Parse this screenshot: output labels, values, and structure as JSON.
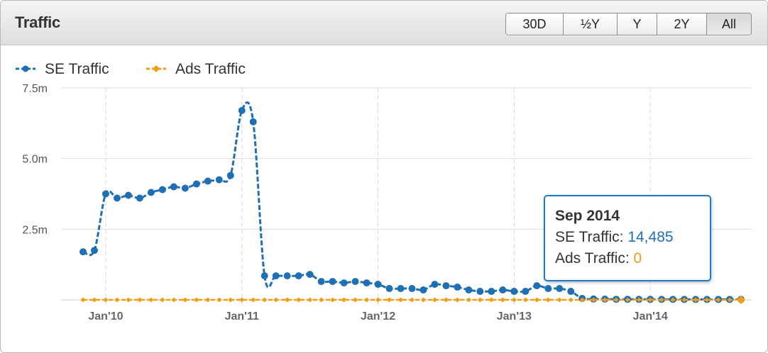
{
  "header": {
    "title": "Traffic",
    "ranges": [
      "30D",
      "½Y",
      "Y",
      "2Y",
      "All"
    ],
    "active_range": "All"
  },
  "tooltip": {
    "title": "Sep 2014",
    "se_label": "SE Traffic: ",
    "se_value": "14,485",
    "ads_label": "Ads Traffic: ",
    "ads_value": "0"
  },
  "colors": {
    "se": "#1f6fb5",
    "ads": "#f39c12",
    "grid": "#dddddd"
  },
  "chart_data": {
    "type": "line",
    "title": "",
    "xlabel": "",
    "ylabel": "",
    "x_ticks": [
      "Jan'10",
      "Jan'11",
      "Jan'12",
      "Jan'13",
      "Jan'14"
    ],
    "y_ticks": [
      "2.5m",
      "5.0m",
      "7.5m"
    ],
    "y_tick_values": [
      2500000,
      5000000,
      7500000
    ],
    "ylim": [
      0,
      7500000
    ],
    "xlim": [
      "2009-10",
      "2014-09"
    ],
    "legend": {
      "placement": "top-left"
    },
    "grid": true,
    "x": [
      "2009-11",
      "2009-12",
      "2010-01",
      "2010-02",
      "2010-03",
      "2010-04",
      "2010-05",
      "2010-06",
      "2010-07",
      "2010-08",
      "2010-09",
      "2010-10",
      "2010-11",
      "2010-12",
      "2011-01",
      "2011-02",
      "2011-03",
      "2011-04",
      "2011-05",
      "2011-06",
      "2011-07",
      "2011-08",
      "2011-09",
      "2011-10",
      "2011-11",
      "2011-12",
      "2012-01",
      "2012-02",
      "2012-03",
      "2012-04",
      "2012-05",
      "2012-06",
      "2012-07",
      "2012-08",
      "2012-09",
      "2012-10",
      "2012-11",
      "2012-12",
      "2013-01",
      "2013-02",
      "2013-03",
      "2013-04",
      "2013-05",
      "2013-06",
      "2013-07",
      "2013-08",
      "2013-09",
      "2013-10",
      "2013-11",
      "2013-12",
      "2014-01",
      "2014-02",
      "2014-03",
      "2014-04",
      "2014-05",
      "2014-06",
      "2014-07",
      "2014-08",
      "2014-09"
    ],
    "series": [
      {
        "name": "SE Traffic",
        "values": [
          1700000,
          1750000,
          3750000,
          3600000,
          3700000,
          3600000,
          3800000,
          3900000,
          4000000,
          3950000,
          4100000,
          4200000,
          4250000,
          4400000,
          6700000,
          6300000,
          850000,
          850000,
          850000,
          850000,
          900000,
          650000,
          650000,
          600000,
          650000,
          600000,
          550000,
          400000,
          400000,
          400000,
          350000,
          550000,
          500000,
          450000,
          350000,
          300000,
          300000,
          350000,
          300000,
          300000,
          500000,
          400000,
          400000,
          300000,
          50000,
          30000,
          25000,
          20000,
          20000,
          18000,
          18000,
          16000,
          16000,
          15000,
          15000,
          15000,
          14500,
          14500,
          14485
        ]
      },
      {
        "name": "Ads Traffic",
        "values": [
          0,
          0,
          0,
          0,
          0,
          0,
          0,
          0,
          0,
          0,
          0,
          0,
          0,
          0,
          0,
          0,
          0,
          0,
          0,
          0,
          0,
          0,
          0,
          0,
          0,
          0,
          0,
          0,
          0,
          0,
          0,
          0,
          0,
          0,
          0,
          0,
          0,
          0,
          0,
          0,
          0,
          0,
          0,
          0,
          0,
          0,
          0,
          0,
          0,
          0,
          0,
          0,
          0,
          0,
          0,
          0,
          0,
          0,
          0
        ]
      }
    ]
  }
}
